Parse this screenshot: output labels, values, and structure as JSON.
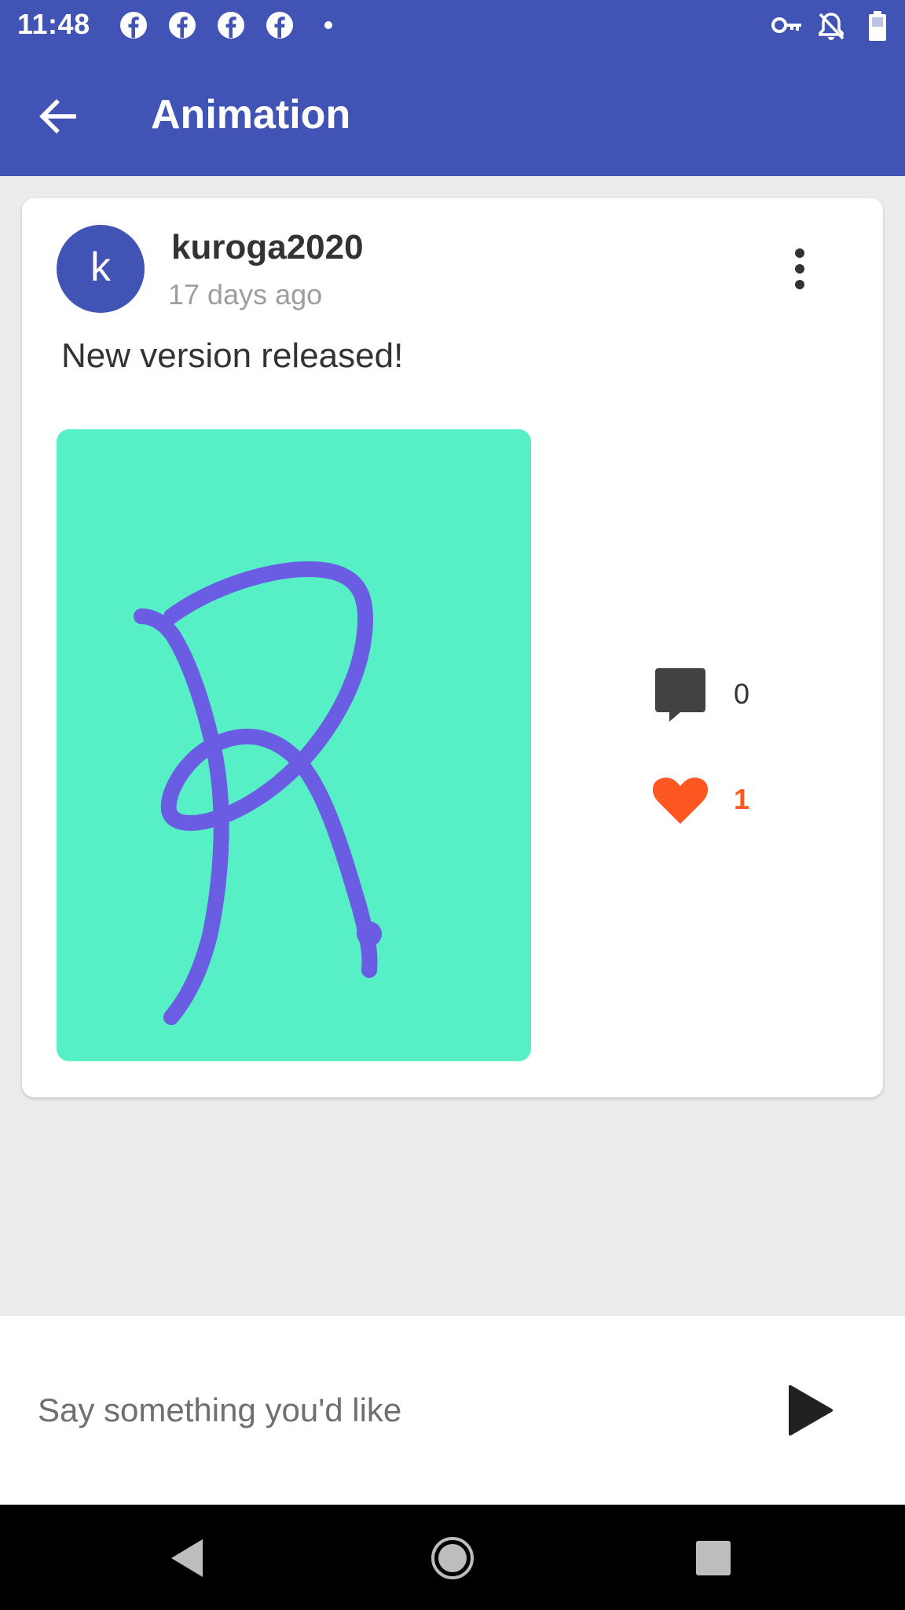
{
  "status_bar": {
    "time": "11:48",
    "notification_icons": [
      "facebook-icon",
      "facebook-icon",
      "facebook-icon",
      "facebook-icon",
      "dot-icon"
    ],
    "system_icons": [
      "vpn-key-icon",
      "notifications-off-icon",
      "battery-icon"
    ]
  },
  "app_bar": {
    "title": "Animation",
    "back_icon": "arrow-back-icon"
  },
  "post": {
    "avatar_letter": "k",
    "username": "kuroga2020",
    "timestamp": "17 days ago",
    "text": "New version released!",
    "menu_icon": "more-vert-icon",
    "image_content": "hand-drawn letter R",
    "comments": {
      "icon": "comment-icon",
      "count": "0"
    },
    "likes": {
      "icon": "heart-icon",
      "count": "1"
    }
  },
  "composer": {
    "placeholder": "Say something you'd like",
    "value": "",
    "send_icon": "send-icon"
  },
  "nav_bar": {
    "buttons": [
      "back-triangle-icon",
      "home-circle-icon",
      "recents-square-icon"
    ]
  },
  "colors": {
    "primary": "#4154b6",
    "image_background": "#57efc5",
    "drawing_stroke": "#6b5de3",
    "like_accent": "#ff5722",
    "icon_dark": "#424242"
  }
}
